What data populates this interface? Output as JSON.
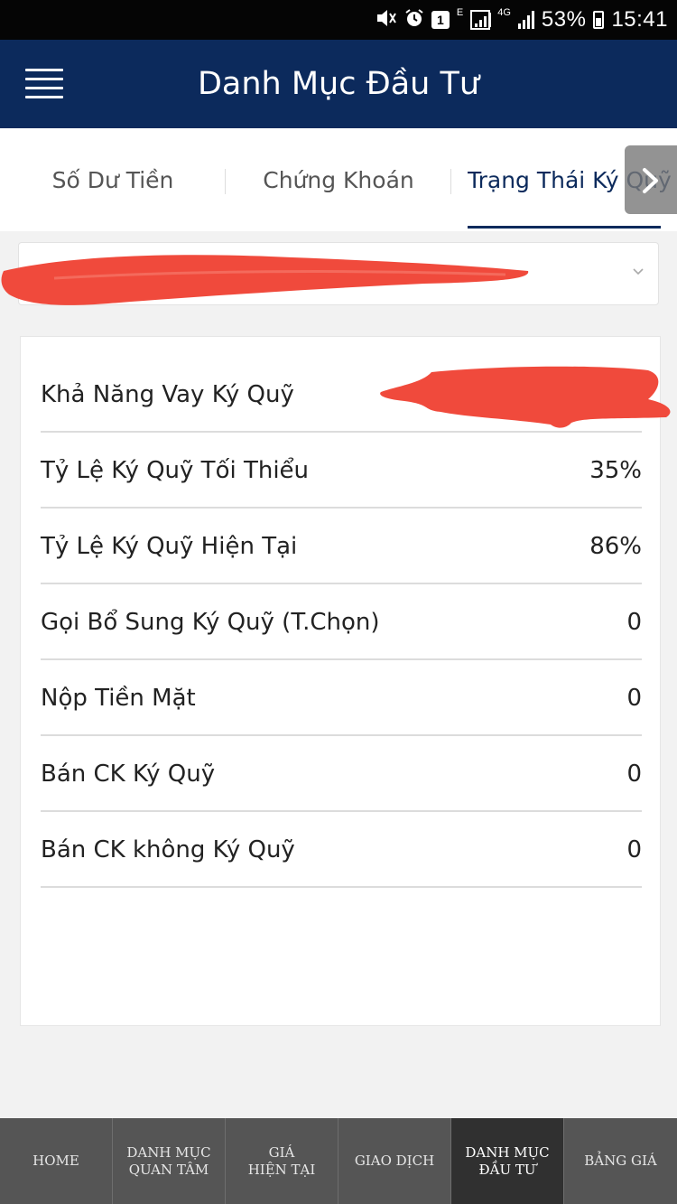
{
  "status_bar": {
    "network_label": "E",
    "lte_label": "4G",
    "sim_badge": "1",
    "battery": "53%",
    "time": "15:41"
  },
  "header": {
    "title": "Danh Mục Đầu Tư"
  },
  "tabs": [
    {
      "label": "Số Dư Tiền",
      "active": false
    },
    {
      "label": "Chứng Khoán",
      "active": false
    },
    {
      "label": "Trạng Thái Ký Quỹ",
      "active": true
    }
  ],
  "margin_status": {
    "rows": [
      {
        "label": "Khả Năng Vay Ký Quỹ",
        "value": ""
      },
      {
        "label": "Tỷ Lệ Ký Quỹ Tối Thiểu",
        "value": "35%"
      },
      {
        "label": "Tỷ Lệ Ký Quỹ Hiện Tại",
        "value": "86%"
      },
      {
        "label": "Gọi Bổ Sung Ký Quỹ (T.Chọn)",
        "value": "0"
      },
      {
        "label": "Nộp Tiền Mặt",
        "value": "0"
      },
      {
        "label": "Bán CK Ký Quỹ",
        "value": "0"
      },
      {
        "label": "Bán CK không Ký Quỹ",
        "value": "0"
      }
    ]
  },
  "bottom_nav": [
    {
      "line1": "HOME",
      "line2": "",
      "active": false
    },
    {
      "line1": "DANH MỤC",
      "line2": "QUAN TÂM",
      "active": false
    },
    {
      "line1": "GIÁ",
      "line2": "HIỆN TẠI",
      "active": false
    },
    {
      "line1": "GIAO DỊCH",
      "line2": "",
      "active": false
    },
    {
      "line1": "DANH MỤC",
      "line2": "ĐẦU TƯ",
      "active": true
    },
    {
      "line1": "BẢNG GIÁ",
      "line2": "",
      "active": false
    }
  ],
  "colors": {
    "header_bg": "#0c2a5c",
    "redaction": "#f04a3c",
    "nav_bg": "#555555",
    "nav_active_bg": "#303030"
  },
  "icons": {
    "menu": "hamburger-icon",
    "tab_scroll": "chevron-right-icon",
    "select": "chevron-down-icon"
  }
}
